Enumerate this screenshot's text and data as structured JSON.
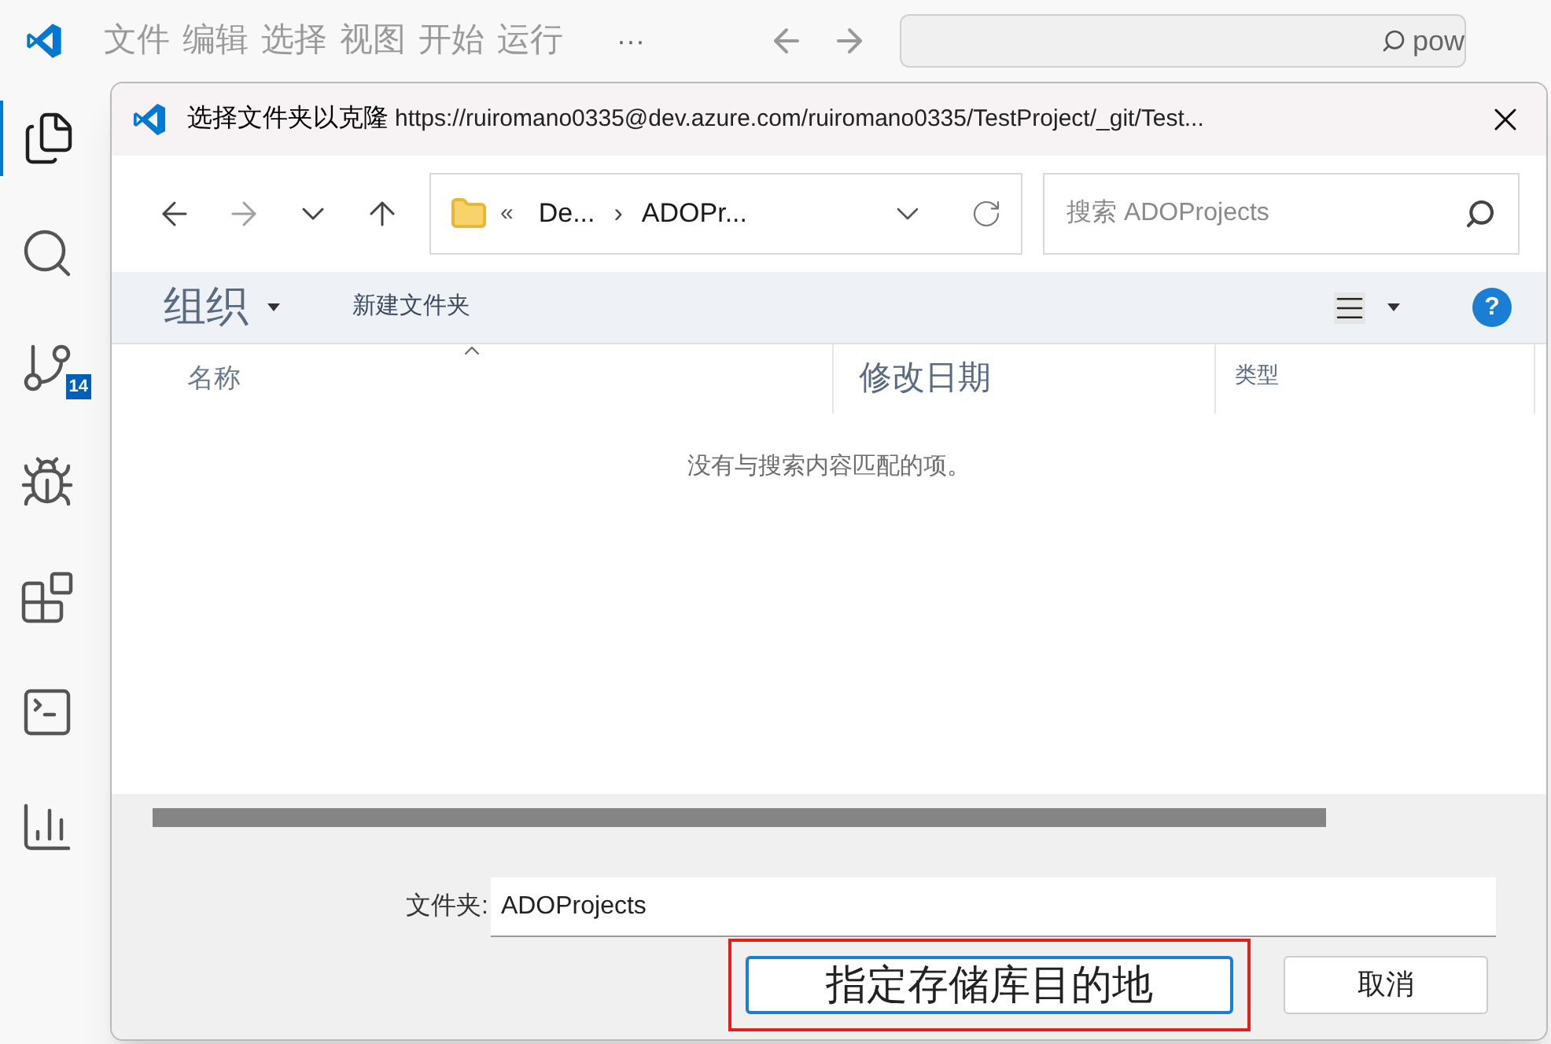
{
  "menu": [
    "文件",
    "编辑",
    "选择",
    "视图",
    "开始",
    "运行"
  ],
  "more": "···",
  "command_search": {
    "value": "pow"
  },
  "activity_bar": {
    "items": [
      {
        "kind": "files",
        "selected": true
      },
      {
        "kind": "search",
        "selected": false
      },
      {
        "kind": "source-control",
        "selected": false,
        "badge": "14"
      },
      {
        "kind": "run-debug",
        "selected": false
      },
      {
        "kind": "extensions",
        "selected": false
      },
      {
        "kind": "terminal",
        "selected": false
      },
      {
        "kind": "chart",
        "selected": false
      }
    ]
  },
  "dialog": {
    "title": "选择文件夹以克隆",
    "url": "https://ruiromano0335@dev.azure.com/ruiromano0335/TestProject/_git/Test...",
    "nav": [
      {
        "kind": "back",
        "disabled": false
      },
      {
        "kind": "forward",
        "disabled": true
      },
      {
        "kind": "recent",
        "disabled": false
      },
      {
        "kind": "up",
        "disabled": false
      }
    ],
    "address": {
      "overflow": "«",
      "separator": "›",
      "crumbs": [
        "De...",
        "ADOPr..."
      ]
    },
    "search": {
      "placeholder": "搜索 ADOProjects"
    },
    "toolbar": {
      "organize": "组织",
      "new_folder": "新建文件夹",
      "help": "?"
    },
    "columns": [
      {
        "label": "名称",
        "sorted": true
      },
      {
        "label": "修改日期",
        "sorted": false
      },
      {
        "label": "类型",
        "sorted": false
      }
    ],
    "empty_message": "没有与搜索内容匹配的项。",
    "folder": {
      "label": "文件夹:",
      "value": "ADOProjects"
    },
    "buttons": [
      {
        "label": "指定存储库目的地",
        "kind": "primary",
        "highlighted": true
      },
      {
        "label": "取消",
        "kind": "secondary",
        "highlighted": false
      }
    ]
  }
}
